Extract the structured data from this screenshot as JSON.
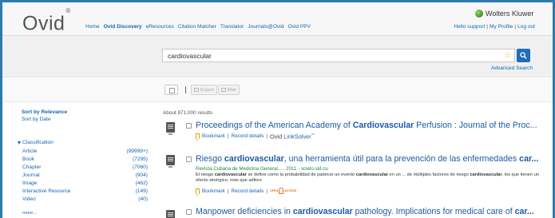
{
  "header": {
    "logo": "Ovid",
    "logo_mark": "®",
    "nav": [
      "Home",
      "Ovid Discovery",
      "eResources",
      "Citation Matcher",
      "Translator",
      "Journals@Ovid",
      "Ovid PPV"
    ],
    "active_nav": "Ovid Discovery",
    "brand": "Wolters Kluwer",
    "user_links": [
      "Hello support",
      "My Profile",
      "Log out"
    ]
  },
  "search": {
    "query": "cardiovascular",
    "advanced_label": "Advanced Search"
  },
  "toolbar": {
    "export_label": "Export",
    "mail_label": "Mail"
  },
  "sidebar": {
    "sort_options": [
      "Sort by Relevance",
      "Sort by Date"
    ],
    "classification_label": "Classification",
    "classification_items": [
      {
        "label": "Article",
        "count": "(99999+)"
      },
      {
        "label": "Book",
        "count": "(7295)"
      },
      {
        "label": "Chapter",
        "count": "(7060)"
      },
      {
        "label": "Journal",
        "count": "(904)"
      },
      {
        "label": "Image",
        "count": "(462)"
      },
      {
        "label": "Interactive Resource",
        "count": "(149)"
      },
      {
        "label": "Video",
        "count": "(40)"
      }
    ],
    "more_label": "more..."
  },
  "results": {
    "count_text": "About 871,000 results",
    "items": [
      {
        "title_pre": "Proceedings of the American Academy of ",
        "title_bold": "Cardiovascular",
        "title_post": " Perfusion : Journal of the Proc...",
        "bookmark": "Bookmark",
        "record": "Record details",
        "ovid_label": "Ovid",
        "linksolver": "LinkSolver",
        "tm": "™"
      },
      {
        "title_pre": "Riesgo ",
        "title_bold": "cardiovascular",
        "title_post": ", una herramienta útil para la prevención de las enfermedades ",
        "title_bold2": "car...",
        "meta": "Revista Cubana de Medicina General... , 2011 - scielo.sld.cu",
        "snippet_1": "El riesgo ",
        "snippet_b1": "cardiovascular",
        "snippet_2": " se define como la probabilidad de padecer un evento ",
        "snippet_b2": "cardiovascular",
        "snippet_3": " en un ... de múltiples factores de riesgo ",
        "snippet_b3": "cardiovascular",
        "snippet_4": ", los que tienen un efecto sinérgico, más que aditivo",
        "bookmark": "Bookmark",
        "record": "Record details",
        "open_label": "OPEN",
        "access_label": "ACCESS"
      },
      {
        "title_pre": "Manpower deficiencies in ",
        "title_bold": "cardiovascular",
        "title_post": " pathology. Implications for medical care of ",
        "title_bold2": "car..."
      }
    ]
  },
  "colors": {
    "frame_bg": "#2b7ab0",
    "link": "#1565b5",
    "title": "#1c5aa6",
    "meta_green": "#1c8a3c",
    "search_button": "#1d6fb8"
  }
}
